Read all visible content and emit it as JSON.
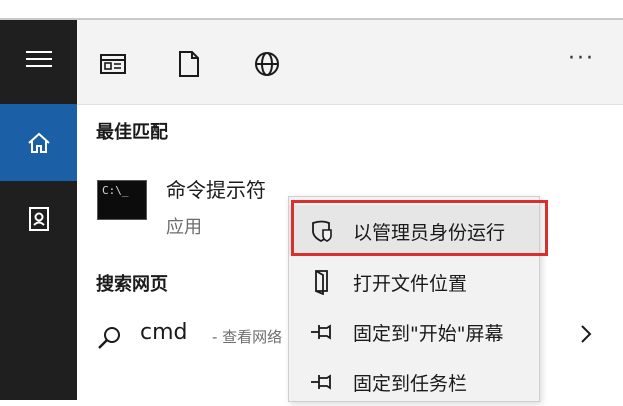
{
  "sidebar": {
    "items": [
      {
        "icon": "hamburger-menu-icon"
      },
      {
        "icon": "home-icon",
        "active": true
      },
      {
        "icon": "profile-book-icon"
      }
    ],
    "accent": "#1b5fa6",
    "background": "#1f1f1f"
  },
  "toolbar": {
    "icons": [
      "app-window-icon",
      "document-icon",
      "globe-icon"
    ],
    "more_label": "···"
  },
  "best_match": {
    "section_title": "最佳匹配",
    "app_name": "命令提示符",
    "app_type": "应用",
    "app_icon_text": "C:\\_"
  },
  "web_search": {
    "section_title": "搜索网页",
    "query": "cmd",
    "suffix": "- 查看网络"
  },
  "context_menu": {
    "items": [
      {
        "label": "以管理员身份运行",
        "icon": "shield-admin-icon",
        "highlighted": true
      },
      {
        "label": "打开文件位置",
        "icon": "folder-location-icon"
      },
      {
        "label": "固定到\"开始\"屏幕",
        "icon": "pin-icon"
      },
      {
        "label": "固定到任务栏",
        "icon": "pin-icon"
      }
    ]
  },
  "colors": {
    "highlight_border": "#d9302e",
    "toolbar_bg": "#f3f3f3"
  }
}
